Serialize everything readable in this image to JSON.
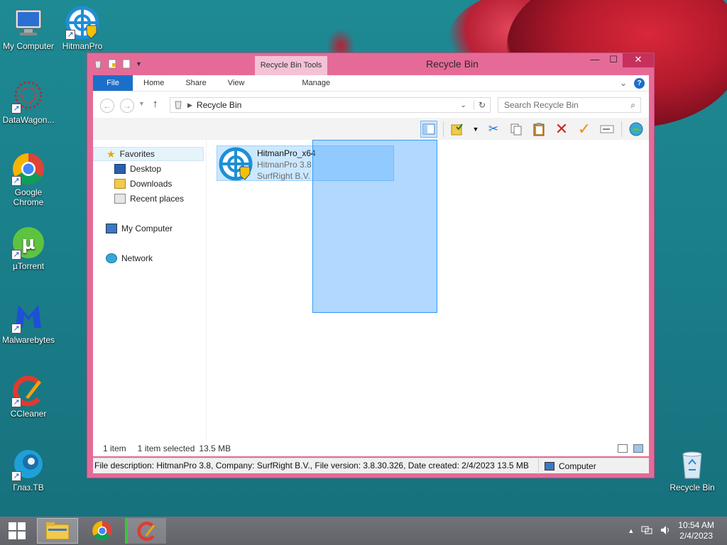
{
  "desktop": {
    "icons": [
      {
        "label": "My Computer"
      },
      {
        "label": "HitmanPro"
      },
      {
        "label": "DataWagon..."
      },
      {
        "label": "Google Chrome"
      },
      {
        "label": "µTorrent"
      },
      {
        "label": "Malwarebytes"
      },
      {
        "label": "CCleaner"
      },
      {
        "label": "Глаз.ТВ"
      },
      {
        "label": "Recycle Bin"
      }
    ]
  },
  "window": {
    "title": "Recycle Bin",
    "context_tab": "Recycle Bin Tools",
    "ribbon_tabs": [
      "File",
      "Home",
      "Share",
      "View",
      "Manage"
    ],
    "address": "Recycle Bin",
    "search_placeholder": "Search Recycle Bin",
    "nav": {
      "favorites": "Favorites",
      "desktop": "Desktop",
      "downloads": "Downloads",
      "recent": "Recent places",
      "computer": "My Computer",
      "network": "Network"
    },
    "file": {
      "name": "HitmanPro_x64",
      "description": "HitmanPro 3.8",
      "company": "SurfRight B.V."
    },
    "status": {
      "count": "1 item",
      "selected": "1 item selected",
      "size": "13.5 MB"
    },
    "details": {
      "text": "File description: HitmanPro 3.8, Company: SurfRight B.V., File version: 3.8.30.326, Date created: 2/4/2023 13.5 MB",
      "location": "Computer"
    }
  },
  "taskbar": {
    "time": "10:54 AM",
    "date": "2/4/2023"
  },
  "colors": {
    "window_frame": "#e66a98",
    "accent_blue": "#1c6fc9",
    "selection": "#cce8ff"
  }
}
